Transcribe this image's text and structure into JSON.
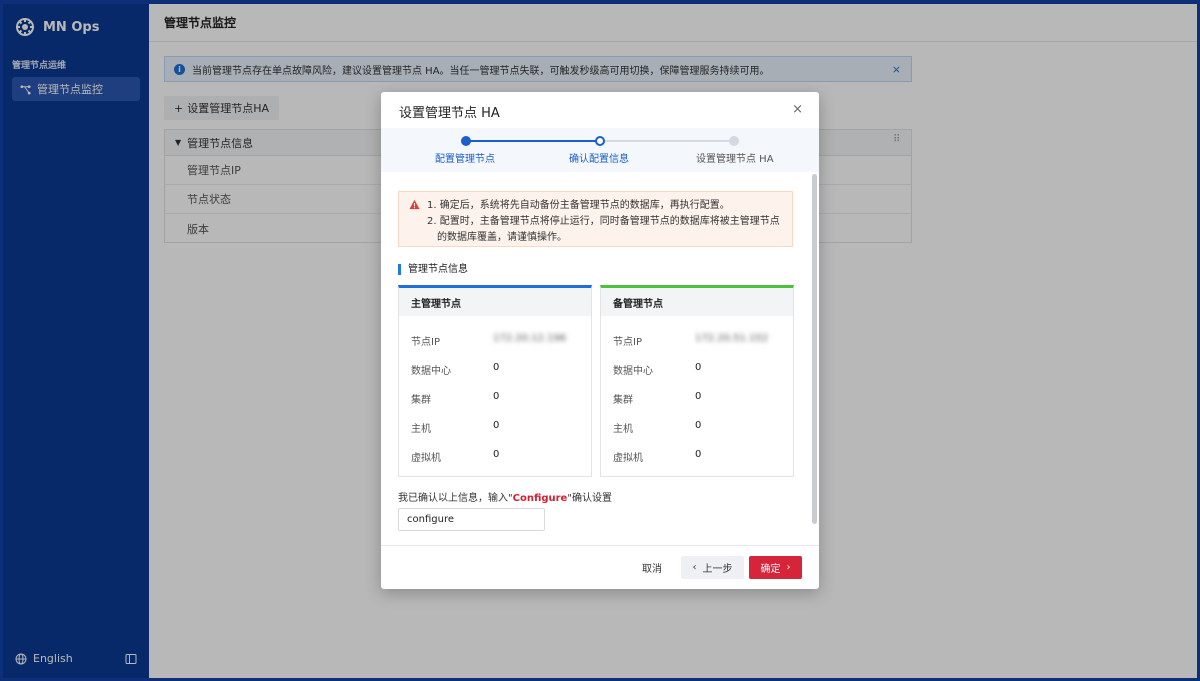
{
  "app": {
    "name": "MN Ops"
  },
  "sidebar": {
    "section_title": "管理节点运维",
    "items": [
      {
        "label": "管理节点监控",
        "icon": "topology-icon"
      }
    ],
    "footer": {
      "language": "English",
      "language_icon": "globe-icon",
      "collapse_icon": "sidebar-collapse-icon"
    }
  },
  "page": {
    "title": "管理节点监控",
    "notice": "当前管理节点存在单点故障风险，建议设置管理节点 HA。当任一管理节点失联，可触发秒级高可用切换，保障管理服务持续可用。",
    "notice_close": "×",
    "add_button": "设置管理节点HA",
    "panel": {
      "title": "管理节点信息",
      "rows": [
        "管理节点IP",
        "节点状态",
        "版本"
      ]
    }
  },
  "modal": {
    "title": "设置管理节点 HA",
    "close": "×",
    "steps": [
      {
        "label": "配置管理节点",
        "state": "done"
      },
      {
        "label": "确认配置信息",
        "state": "current"
      },
      {
        "label": "设置管理节点 HA",
        "state": "pending"
      }
    ],
    "warning": {
      "line1": "1. 确定后，系统将先自动备份主备管理节点的数据库，再执行配置。",
      "line2": "2. 配置时，主备管理节点将停止运行，同时备管理节点的数据库将被主管理节点",
      "line3": "的数据库覆盖，请谨慎操作。"
    },
    "section_title": "管理节点信息",
    "primary": {
      "title": "主管理节点",
      "fields": [
        {
          "key": "节点IP",
          "value": "172.20.12.196"
        },
        {
          "key": "数据中心",
          "value": "0"
        },
        {
          "key": "集群",
          "value": "0"
        },
        {
          "key": "主机",
          "value": "0"
        },
        {
          "key": "虚拟机",
          "value": "0"
        }
      ]
    },
    "backup": {
      "title": "备管理节点",
      "fields": [
        {
          "key": "节点IP",
          "value": "172.20.51.152"
        },
        {
          "key": "数据中心",
          "value": "0"
        },
        {
          "key": "集群",
          "value": "0"
        },
        {
          "key": "主机",
          "value": "0"
        },
        {
          "key": "虚拟机",
          "value": "0"
        }
      ]
    },
    "confirm": {
      "prefix": "我已确认以上信息，输入\"",
      "keyword": "Configure",
      "suffix": "\"确认设置",
      "input_value": "configure"
    },
    "buttons": {
      "cancel": "取消",
      "prev": "上一步",
      "ok": "确定"
    }
  },
  "colors": {
    "sidebar_bg": "#0b3a92",
    "primary": "#1a5fcc",
    "danger": "#d6243a",
    "success": "#4cc23a"
  }
}
